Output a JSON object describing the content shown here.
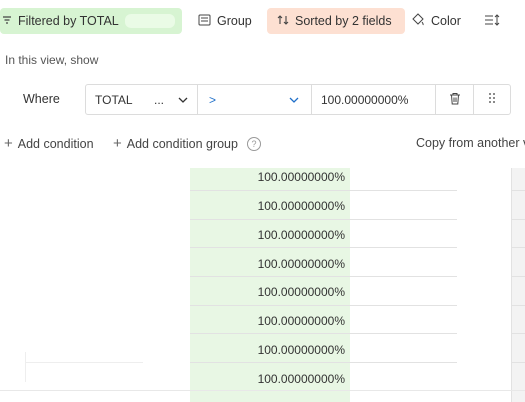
{
  "toolbar": {
    "filter_label": "Filtered by TOTAL",
    "group_label": "Group",
    "sort_label": "Sorted by 2 fields",
    "color_label": "Color"
  },
  "filter_panel": {
    "caption": "In this view, show",
    "where_label": "Where",
    "condition": {
      "field": "TOTAL",
      "field_overflow": "...",
      "operator": ">",
      "value": "100.00000000%"
    },
    "add_condition_label": "Add condition",
    "add_group_label": "Add condition group",
    "copy_label": "Copy from another v"
  },
  "grid": {
    "values": [
      "100.00000000%",
      "100.00000000%",
      "100.00000000%",
      "100.00000000%",
      "100.00000000%",
      "100.00000000%",
      "100.00000000%",
      "100.00000000%"
    ]
  },
  "colors": {
    "filter_bg": "#d7f4d2",
    "sort_bg": "#fde0d2",
    "operator_text": "#1f6fc9",
    "highlight_column": "#e8f7e4"
  },
  "icons": [
    "filter-icon",
    "group-icon",
    "sort-icon",
    "color-icon",
    "row-height-icon",
    "chevron-down-icon",
    "trash-icon",
    "drag-handle-icon",
    "plus-icon",
    "help-icon"
  ]
}
